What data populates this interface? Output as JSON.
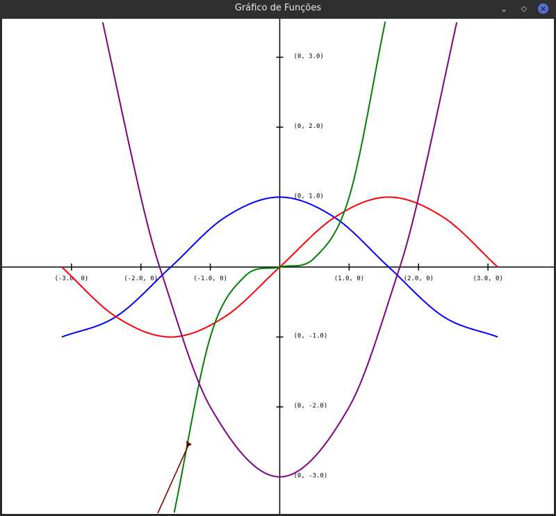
{
  "window": {
    "title": "Gráfico de Funções",
    "buttons": {
      "minimize_icon": "minimize-icon",
      "maximize_icon": "maximize-icon",
      "close_icon": "close-icon"
    }
  },
  "chart_data": {
    "type": "line",
    "title": "",
    "xlabel": "",
    "ylabel": "",
    "xlim": [
      -4.0,
      3.95
    ],
    "ylim": [
      -3.53,
      3.55
    ],
    "grid": false,
    "x_ticks": [
      {
        "value": -3,
        "label": "(-3.0, 0)"
      },
      {
        "value": -2,
        "label": "(-2.0, 0)"
      },
      {
        "value": -1,
        "label": "(-1.0, 0)"
      },
      {
        "value": 1,
        "label": "(1.0, 0)"
      },
      {
        "value": 2,
        "label": "(2.0, 0)"
      },
      {
        "value": 3,
        "label": "(3.0, 0)"
      }
    ],
    "y_ticks": [
      {
        "value": 3,
        "label": "(0, 3.0)"
      },
      {
        "value": 2,
        "label": "(0, 2.0)"
      },
      {
        "value": 1,
        "label": "(0, 1.0)"
      },
      {
        "value": -1,
        "label": "(0, -1.0)"
      },
      {
        "value": -2,
        "label": "(0, -2.0)"
      },
      {
        "value": -3,
        "label": "(0, -3.0)"
      }
    ],
    "series": [
      {
        "color": "#0000ff",
        "x_range": [
          -3.14,
          3.14
        ],
        "points": [
          [
            -3.14,
            -1.0
          ],
          [
            -2.36,
            -0.71
          ],
          [
            -1.57,
            0.0
          ],
          [
            -0.79,
            0.71
          ],
          [
            0,
            1.0
          ],
          [
            0.79,
            0.71
          ],
          [
            1.57,
            0.0
          ],
          [
            2.36,
            -0.71
          ],
          [
            3.14,
            -1.0
          ]
        ]
      },
      {
        "color": "#ff0000",
        "x_range": [
          -3.14,
          3.14
        ],
        "points": [
          [
            -3.14,
            0.0
          ],
          [
            -2.36,
            -0.71
          ],
          [
            -1.57,
            -1.0
          ],
          [
            -0.79,
            -0.71
          ],
          [
            0,
            0.0
          ],
          [
            0.79,
            0.71
          ],
          [
            1.57,
            1.0
          ],
          [
            2.36,
            0.71
          ],
          [
            3.14,
            0.0
          ]
        ]
      },
      {
        "color": "#008000",
        "x_range": [
          -1.52,
          1.52
        ],
        "points": [
          [
            -1.52,
            -3.51
          ],
          [
            -1.0,
            -1.0
          ],
          [
            -0.5,
            -0.13
          ],
          [
            0,
            0.0
          ],
          [
            0.5,
            0.13
          ],
          [
            1.0,
            1.0
          ],
          [
            1.52,
            3.51
          ]
        ]
      },
      {
        "color": "#800080",
        "x_range": [
          -2.55,
          2.55
        ],
        "points": [
          [
            -2.55,
            3.5
          ],
          [
            -2.0,
            1.0
          ],
          [
            -1.73,
            0.0
          ],
          [
            -1.0,
            -2.0
          ],
          [
            0,
            -3.0
          ],
          [
            1.0,
            -2.0
          ],
          [
            1.73,
            0.0
          ],
          [
            2.0,
            1.0
          ],
          [
            2.55,
            3.5
          ]
        ]
      }
    ]
  }
}
